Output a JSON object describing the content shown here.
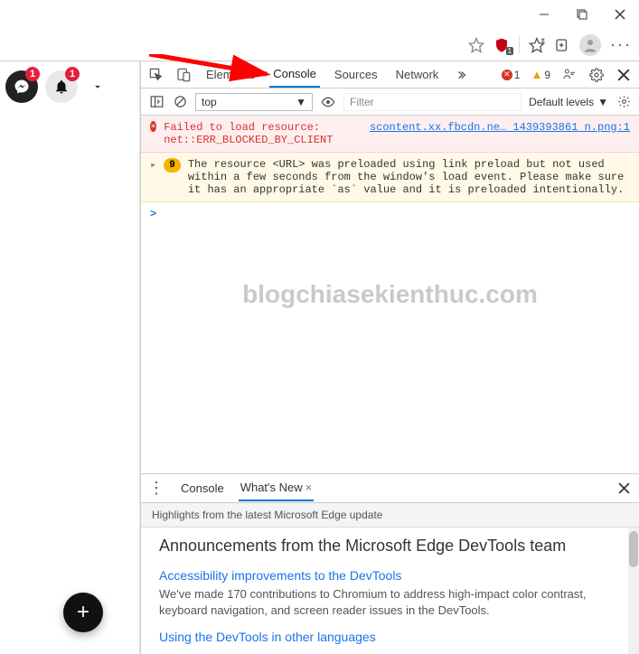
{
  "window": {
    "shield_badge": "1"
  },
  "bubbles": {
    "msg_badge": "1",
    "bell_badge": "1"
  },
  "devtools": {
    "tabs": [
      "Elements",
      "Console",
      "Sources",
      "Network"
    ],
    "active_tab": "Console",
    "errors": "1",
    "warnings": "9",
    "context": "top",
    "filter_placeholder": "Filter",
    "levels": "Default levels"
  },
  "console": {
    "error": {
      "text": "Failed to load resource: net::ERR_BLOCKED_BY_CLIENT",
      "link": "scontent.xx.fbcdn.ne… 1439393861 n.png:1"
    },
    "warning": {
      "count": "9",
      "text": "The resource <URL> was preloaded using link preload but not used within a few seconds from the window's load event. Please make sure it has an appropriate `as` value and it is preloaded intentionally."
    },
    "prompt": ">"
  },
  "watermark": "blogchiasekienthuc.com",
  "drawer": {
    "tabs": [
      "Console",
      "What's New"
    ],
    "active": "What's New",
    "subtitle": "Highlights from the latest Microsoft Edge update",
    "heading": "Announcements from the Microsoft Edge DevTools team",
    "items": [
      {
        "title": "Accessibility improvements to the DevTools",
        "body": "We've made 170 contributions to Chromium to address high-impact color contrast, keyboard navigation, and screen reader issues in the DevTools."
      },
      {
        "title": "Using the DevTools in other languages",
        "body": ""
      }
    ]
  },
  "fab": "+"
}
